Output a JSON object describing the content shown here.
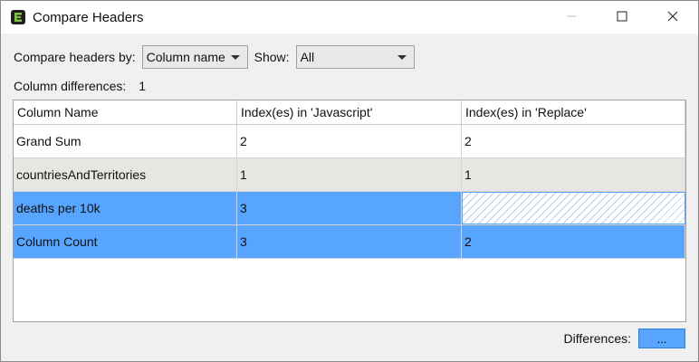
{
  "window": {
    "title": "Compare Headers",
    "controls": {
      "minimize": "—",
      "maximize": "☐",
      "close": "✕"
    }
  },
  "toolbar": {
    "compare_by_label": "Compare headers by:",
    "compare_by_value": "Column name",
    "show_label": "Show:",
    "show_value": "All"
  },
  "summary": {
    "label": "Column differences:",
    "count": "1"
  },
  "table": {
    "headers": [
      "Column Name",
      "Index(es) in 'Javascript'",
      "Index(es) in 'Replace'"
    ],
    "rows": [
      {
        "name": "Grand Sum",
        "js": "2",
        "replace": "2",
        "state": "normal"
      },
      {
        "name": "countriesAndTerritories",
        "js": "1",
        "replace": "1",
        "state": "alternate"
      },
      {
        "name": "deaths per 10k",
        "js": "3",
        "replace": "",
        "state": "selected-missing"
      },
      {
        "name": "Column Count",
        "js": "3",
        "replace": "2",
        "state": "selected"
      }
    ]
  },
  "footer": {
    "differences_label": "Differences:",
    "differences_button": "..."
  },
  "colors": {
    "selection": "#57a5ff",
    "alternate_row": "#e8e6e2"
  },
  "icons": [
    "app-logo-icon",
    "minimize-icon",
    "maximize-icon",
    "close-icon",
    "dropdown-caret-icon"
  ]
}
